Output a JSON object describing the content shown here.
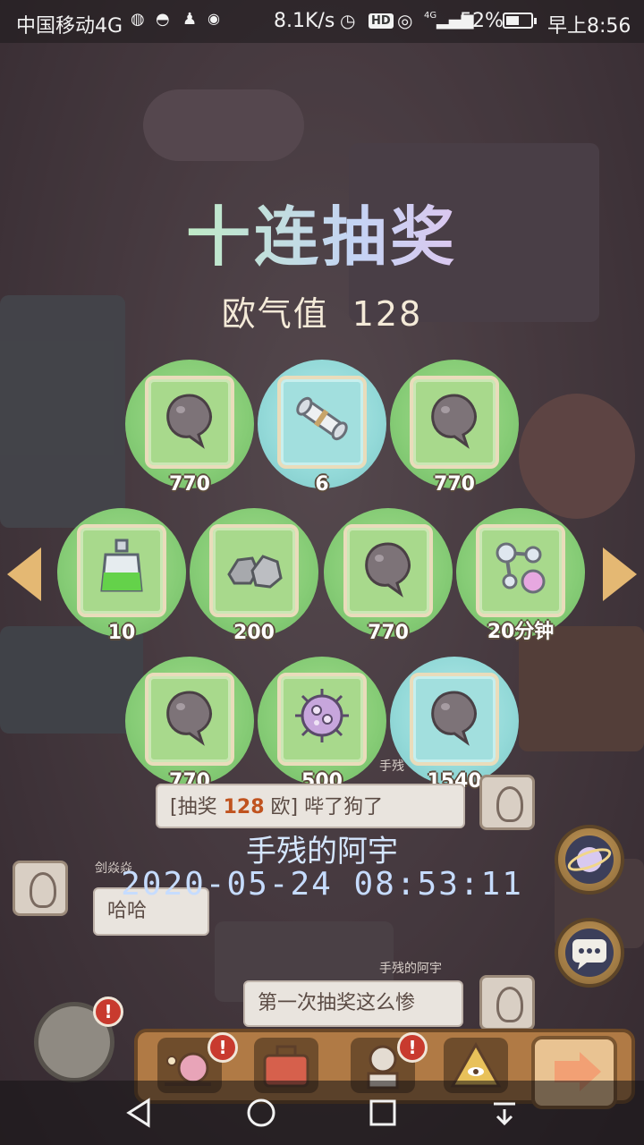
{
  "status_bar": {
    "carrier": "中国移动4G",
    "speed": "8.1K/s",
    "hd": "HD",
    "signal": "4G",
    "battery": "52%",
    "battery_level": 0.52,
    "time": "早上8:56"
  },
  "draw": {
    "title": "十连抽奖",
    "luck_label": "欧气值",
    "luck_value": "128"
  },
  "rewards": [
    {
      "icon": "ghost-icon",
      "count": "770",
      "color": "green"
    },
    {
      "icon": "scroll-icon",
      "count": "6",
      "color": "blue"
    },
    {
      "icon": "ghost-icon",
      "count": "770",
      "color": "green"
    },
    {
      "icon": "potion-bottle-icon",
      "count": "10",
      "color": "green"
    },
    {
      "icon": "stones-icon",
      "count": "200",
      "color": "green"
    },
    {
      "icon": "ghost-icon",
      "count": "770",
      "color": "green"
    },
    {
      "icon": "molecule-flask-icon",
      "count": "20分钟",
      "color": "green"
    },
    {
      "icon": "ghost-icon",
      "count": "770",
      "color": "green"
    },
    {
      "icon": "virus-icon",
      "count": "500",
      "color": "green"
    },
    {
      "icon": "ghost-icon",
      "count": "1540",
      "color": "blue"
    }
  ],
  "chat": {
    "msg1_prefix": "[抽奖 ",
    "msg1_value": "128",
    "msg1_suffix": " 欧]",
    "msg1_tail": " 哔了狗了",
    "name_left": "剑焱焱",
    "msg2": "哈哈",
    "name_right": "手残的阿宇",
    "msg3": "第一次抽奖这么惨",
    "name_top": "手残"
  },
  "player": {
    "name": "手残的阿宇",
    "timestamp": "2020-05-24 08:53:11"
  },
  "badge_mark": "!",
  "colors": {
    "green_circle": "#86cc76",
    "blue_circle": "#93d9d8",
    "title_gradient": [
      "#f6e8a4",
      "#bfe9c8",
      "#c4d4f4",
      "#e8c0ec"
    ],
    "timestamp": "#c6dcff"
  }
}
